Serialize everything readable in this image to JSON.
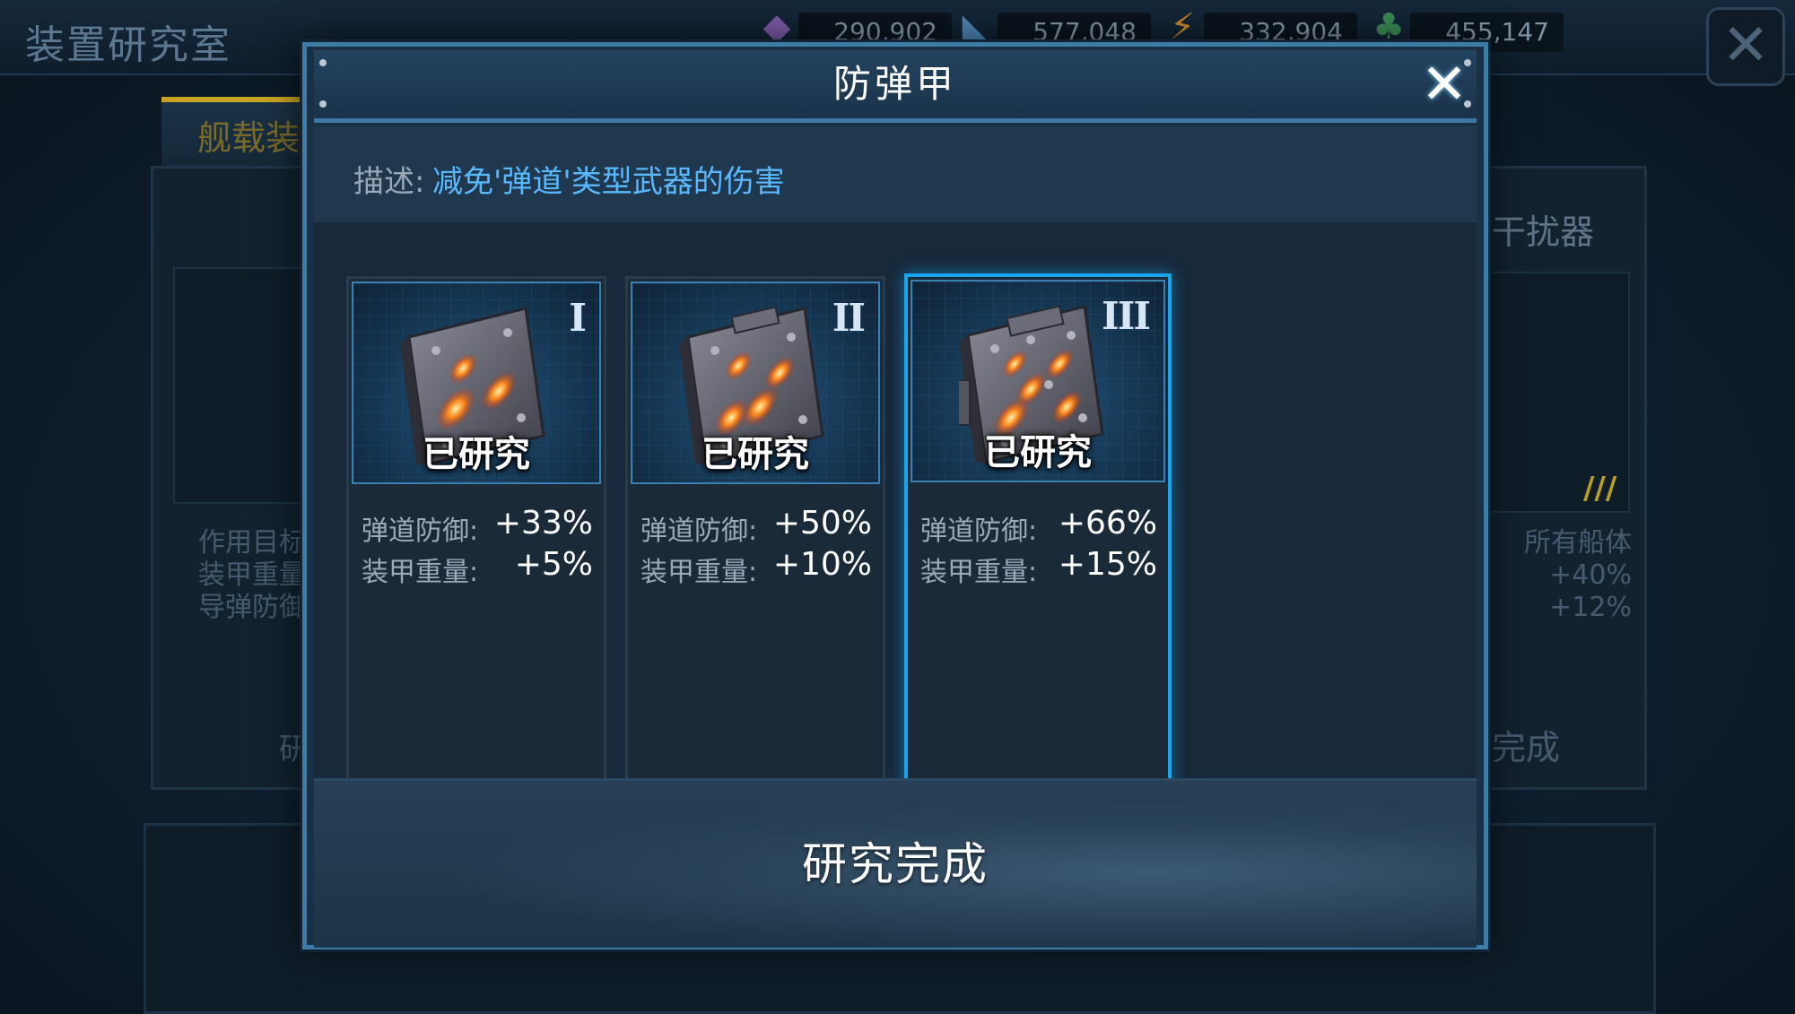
{
  "background": {
    "title": "装置研究室",
    "resources": [
      {
        "icon": "crystal-icon",
        "value": "290,902"
      },
      {
        "icon": "fuel-icon",
        "value": "577,048"
      },
      {
        "icon": "energy-icon",
        "value": "332,904"
      },
      {
        "icon": "alloy-icon",
        "value": "455,147"
      }
    ],
    "tab_label": "舰载装",
    "right_card_title": "干扰器",
    "right_card_lines": [
      "所有船体",
      "+40%",
      "+12%"
    ],
    "right_card_status": "完成",
    "left_card_lines": [
      "作用目标",
      "装甲重量",
      "导弹防御"
    ],
    "left_card_status": "研"
  },
  "modal": {
    "title": "防弹甲",
    "close_glyph": "✕",
    "description_label": "描述:",
    "description_text": "减免'弹道'类型武器的伤害",
    "levels": [
      {
        "tier": "I",
        "status": "已研究",
        "stat1_label": "弹道防御:",
        "stat1_value": "+33%",
        "stat2_label": "装甲重量:",
        "stat2_value": "+5%"
      },
      {
        "tier": "II",
        "status": "已研究",
        "stat1_label": "弹道防御:",
        "stat1_value": "+50%",
        "stat2_label": "装甲重量:",
        "stat2_value": "+10%"
      },
      {
        "tier": "III",
        "status": "已研究",
        "stat1_label": "弹道防御:",
        "stat1_value": "+66%",
        "stat2_label": "装甲重量:",
        "stat2_value": "+15%"
      }
    ],
    "selected_level": "III",
    "footer_button": "研究完成"
  },
  "colors": {
    "accent": "#18a6ee",
    "description_text": "#5ab8ff",
    "frame": "#3d7ca7"
  }
}
